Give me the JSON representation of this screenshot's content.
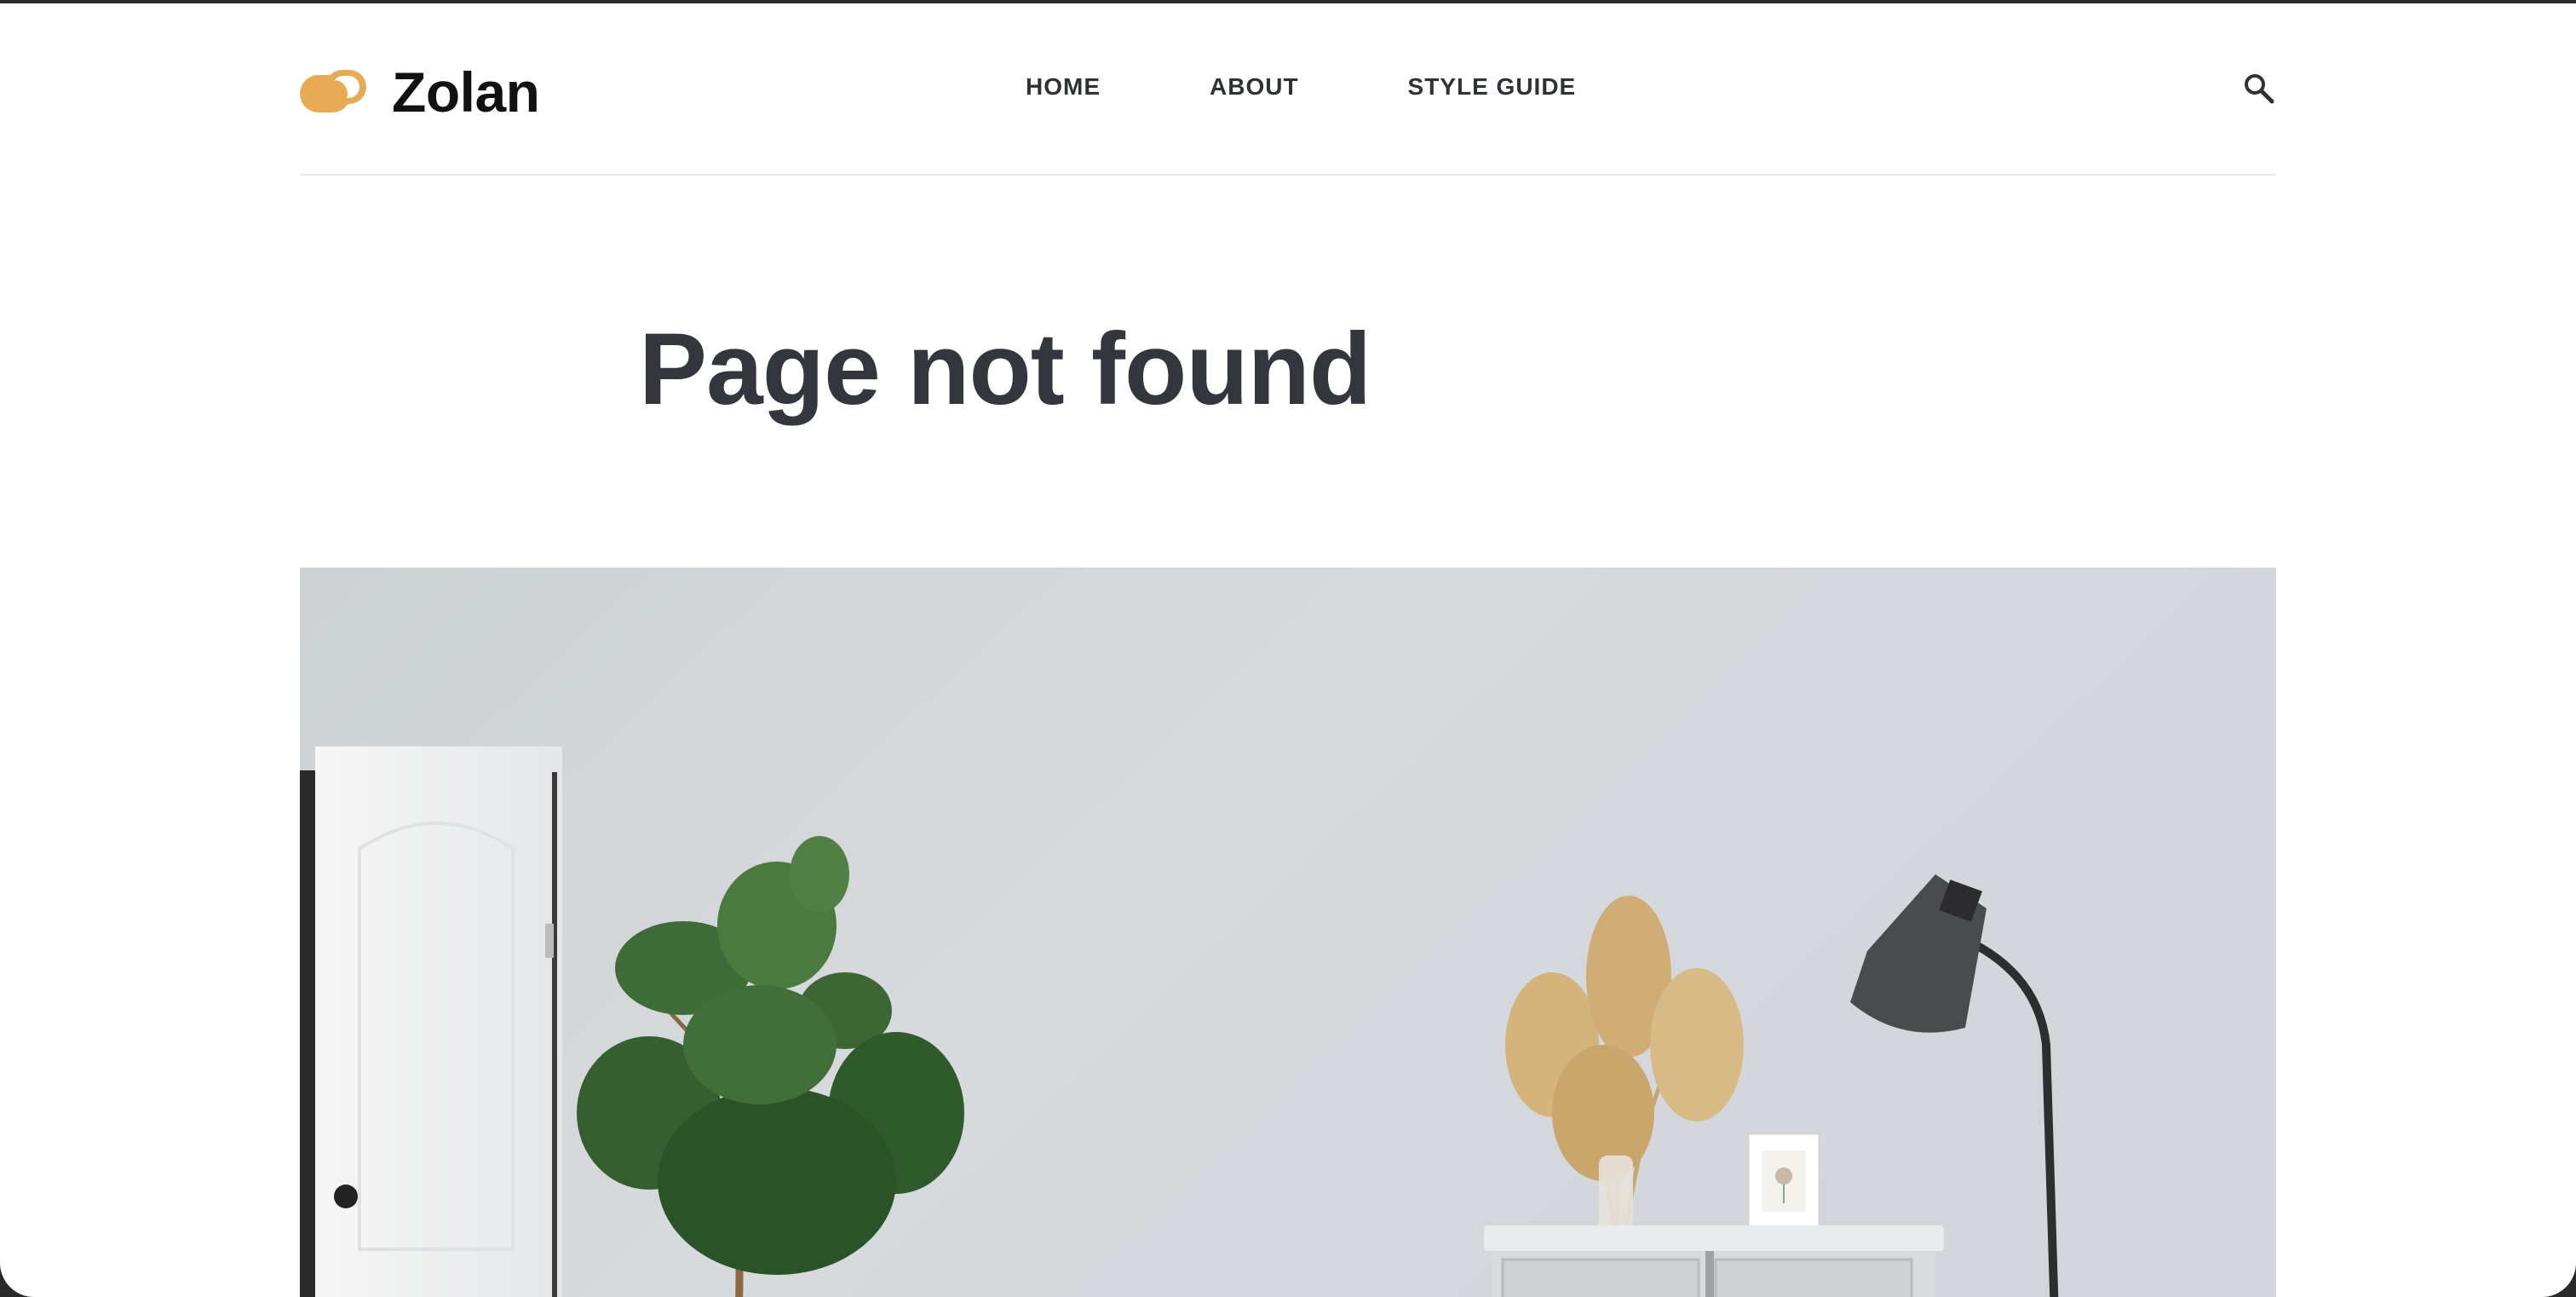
{
  "brand": {
    "name": "Zolan",
    "accent_color": "#e8ab55"
  },
  "nav": {
    "items": [
      {
        "label": "HOME"
      },
      {
        "label": "ABOUT"
      },
      {
        "label": "STYLE GUIDE"
      }
    ],
    "search_icon": "search-icon"
  },
  "main": {
    "title": "Page not found",
    "hero_image": {
      "subject": "interior-scene"
    }
  }
}
